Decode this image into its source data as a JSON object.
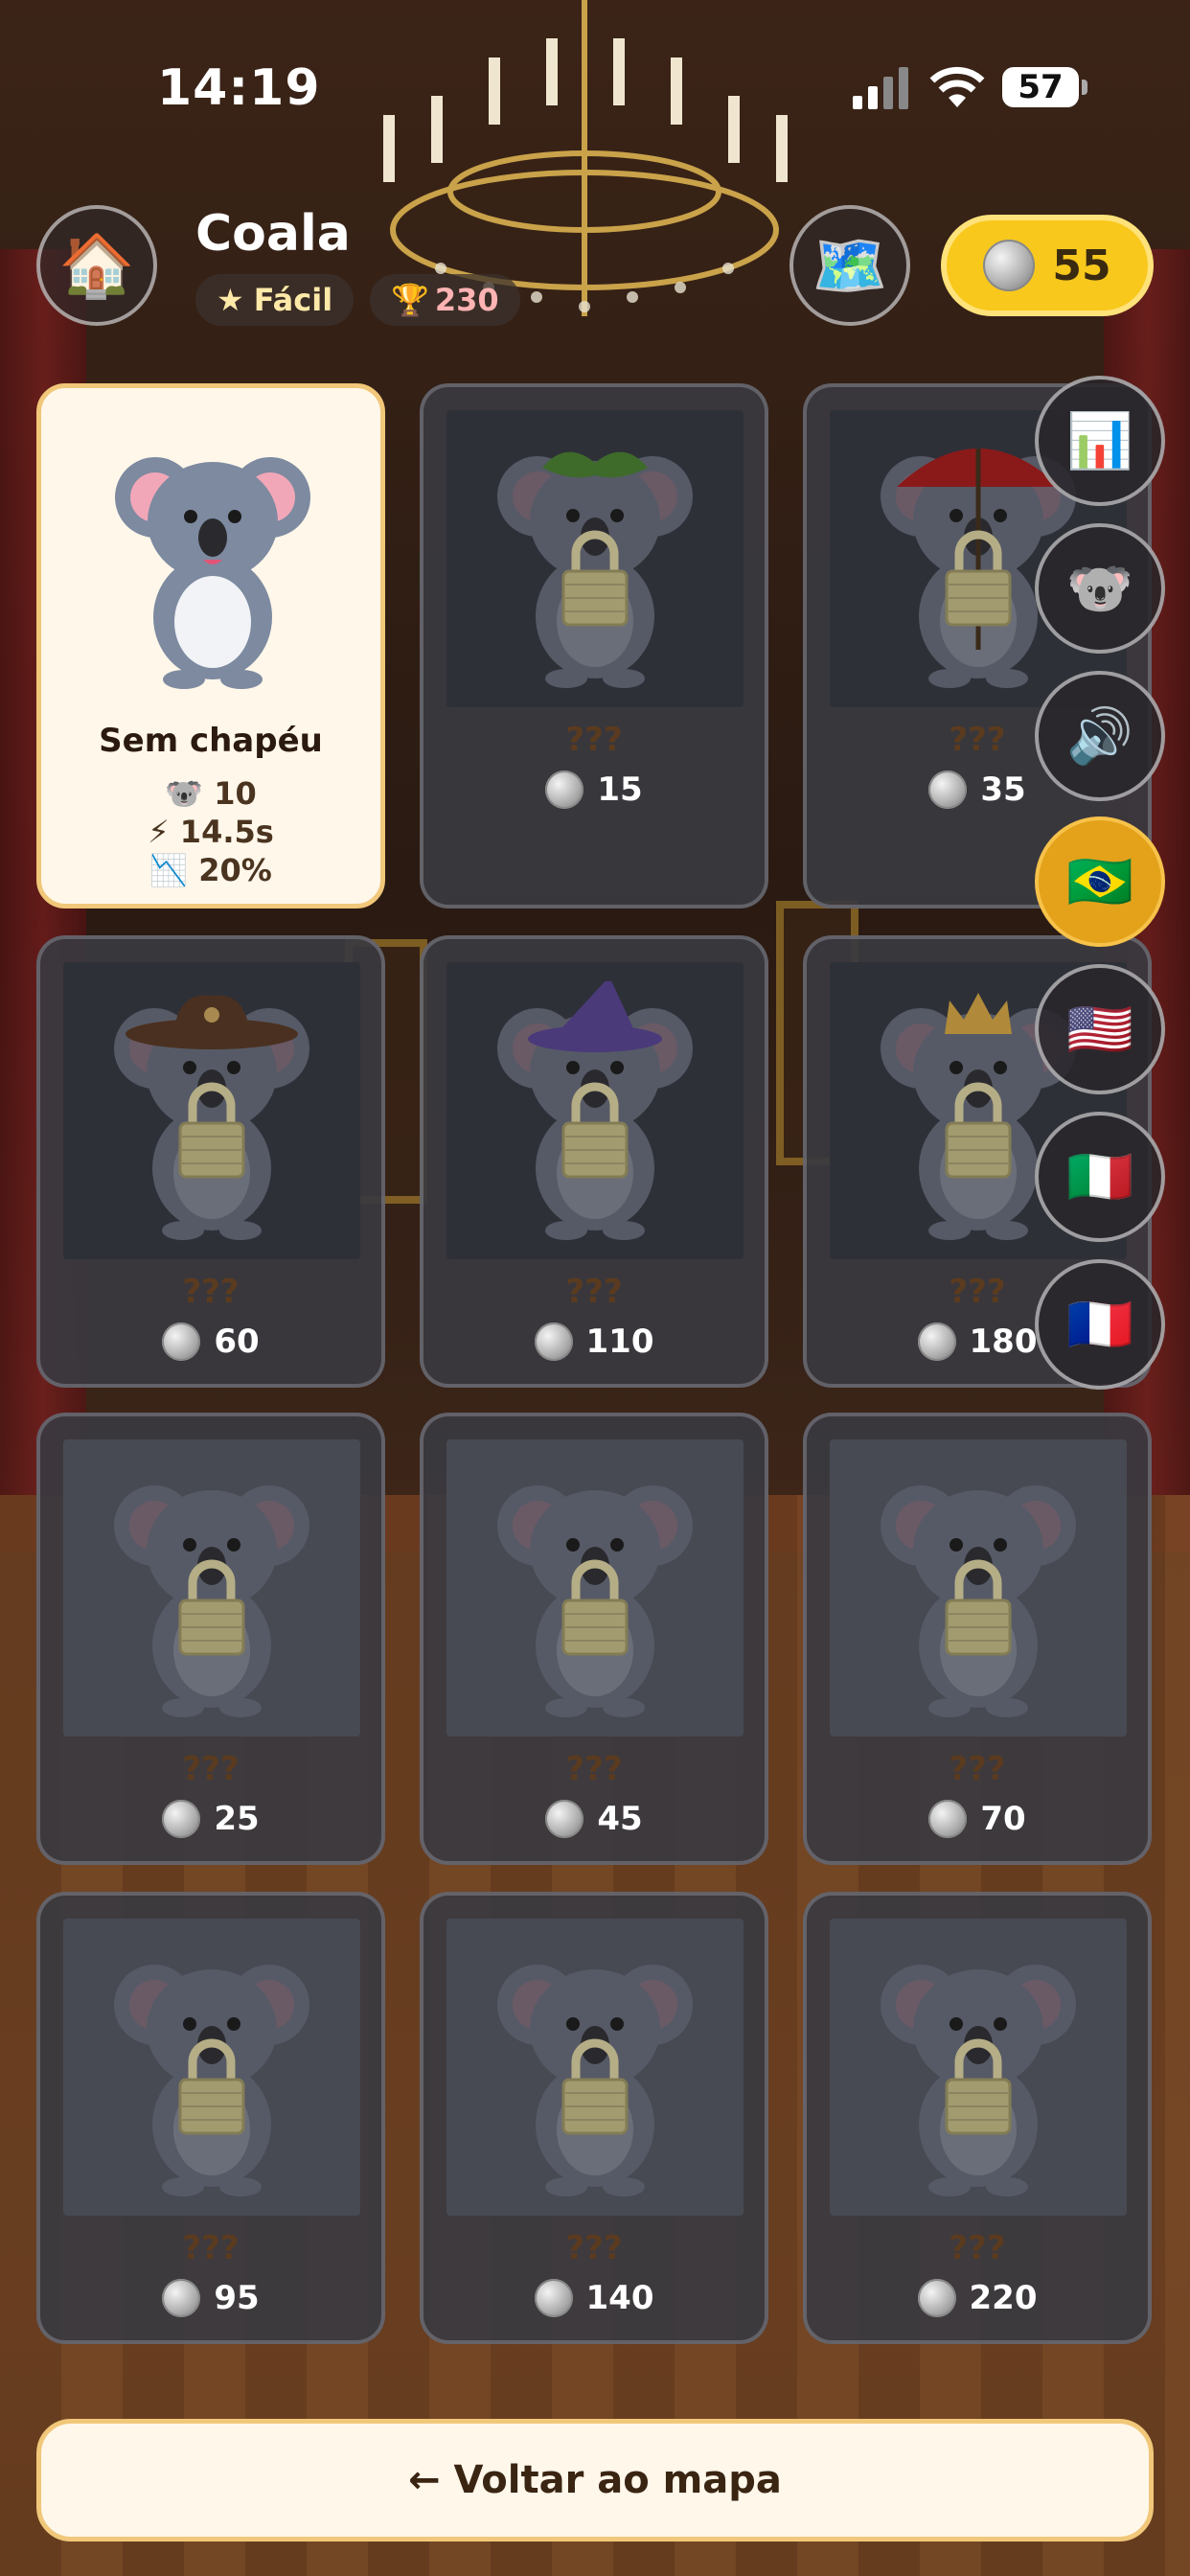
{
  "status_bar": {
    "time": "14:19",
    "battery": "57"
  },
  "header": {
    "home_icon": "house-icon",
    "title": "Coala",
    "difficulty": "Fácil",
    "trophies": "230",
    "map_icon": "world-map-icon",
    "coins": "55"
  },
  "side_menu": [
    {
      "name": "stats",
      "icon": "bar-chart-icon",
      "glyph": "📊",
      "selected": false
    },
    {
      "name": "character",
      "icon": "koala-icon",
      "glyph": "🐨",
      "selected": false
    },
    {
      "name": "sound",
      "icon": "speaker-icon",
      "glyph": "🔊",
      "selected": false
    },
    {
      "name": "lang-pt-br",
      "icon": "brazil-flag-icon",
      "glyph": "🇧🇷",
      "selected": true
    },
    {
      "name": "lang-en-us",
      "icon": "usa-flag-icon",
      "glyph": "🇺🇸",
      "selected": false
    },
    {
      "name": "lang-it",
      "icon": "italy-flag-icon",
      "glyph": "🇮🇹",
      "selected": false
    },
    {
      "name": "lang-fr",
      "icon": "france-flag-icon",
      "glyph": "🇫🇷",
      "selected": false
    }
  ],
  "hats": [
    {
      "name": "Sem chapéu",
      "locked": false,
      "koalas": "10",
      "speed": "14.5s",
      "drop": "20%",
      "hat": "none"
    },
    {
      "name": "???",
      "locked": true,
      "price": "15",
      "hat": "leaf"
    },
    {
      "name": "???",
      "locked": true,
      "price": "35",
      "hat": "umbrella"
    },
    {
      "name": "???",
      "locked": true,
      "price": "60",
      "hat": "cowboy"
    },
    {
      "name": "???",
      "locked": true,
      "price": "110",
      "hat": "wizard"
    },
    {
      "name": "???",
      "locked": true,
      "price": "180",
      "hat": "crown"
    },
    {
      "name": "???",
      "locked": true,
      "price": "25",
      "hat": "none"
    },
    {
      "name": "???",
      "locked": true,
      "price": "45",
      "hat": "none"
    },
    {
      "name": "???",
      "locked": true,
      "price": "70",
      "hat": "none"
    },
    {
      "name": "???",
      "locked": true,
      "price": "95",
      "hat": "none"
    },
    {
      "name": "???",
      "locked": true,
      "price": "140",
      "hat": "none"
    },
    {
      "name": "???",
      "locked": true,
      "price": "220",
      "hat": "none"
    }
  ],
  "footer": {
    "back_label": "← Voltar ao mapa"
  }
}
